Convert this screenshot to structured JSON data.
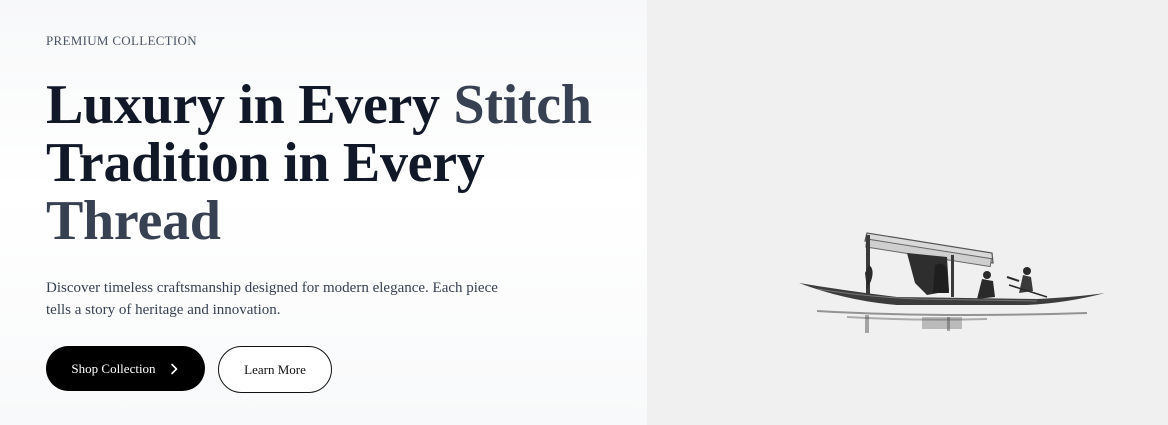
{
  "hero": {
    "eyebrow": "PREMIUM COLLECTION",
    "headline": {
      "line1_main": "Luxury in Every ",
      "line1_accent": "Stitch",
      "line2_main": "Tradition in Every",
      "line3_accent": "Thread"
    },
    "description": "Discover timeless craftsmanship designed for modern elegance. Each piece tells a story of heritage and innovation.",
    "primary_button": {
      "label": "Shop Collection",
      "icon": "chevron-right-icon"
    },
    "secondary_button": {
      "label": "Learn More"
    }
  },
  "media": {
    "image": "shikara-boat-silhouette",
    "background": "#f0f0f0"
  },
  "colors": {
    "headline": "#111827",
    "accent": "#374151",
    "primary_button_bg": "#000000",
    "body_text": "#374151"
  }
}
